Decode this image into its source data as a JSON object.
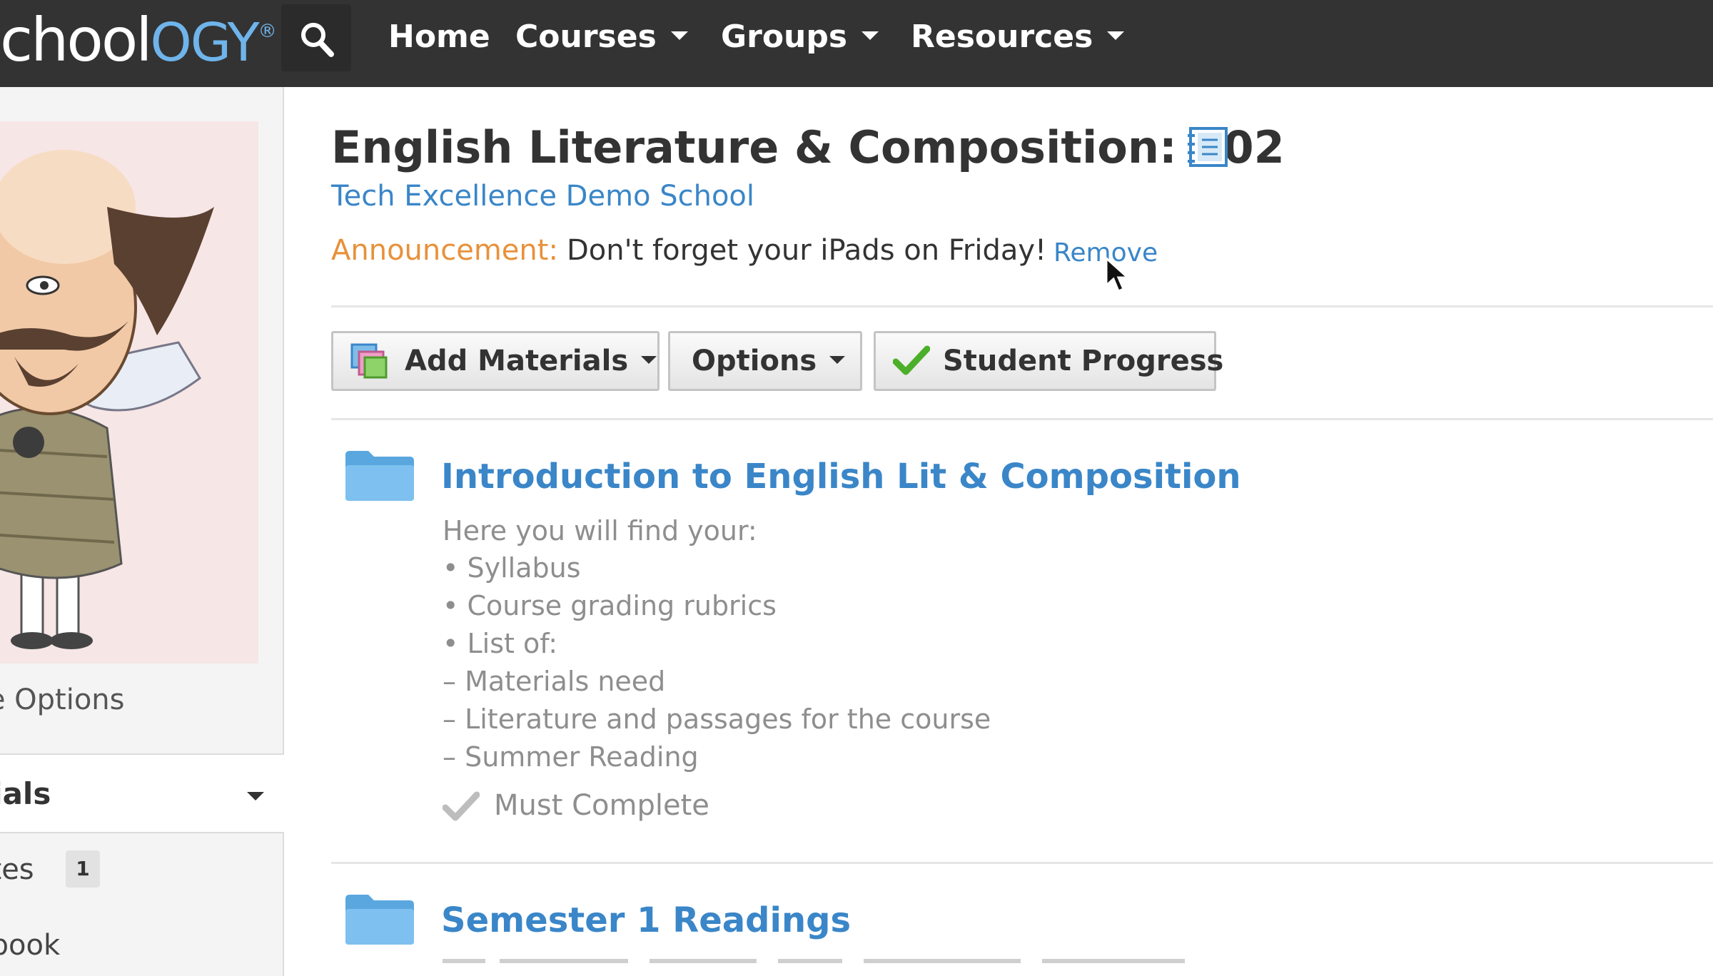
{
  "header": {
    "logo_main": "chool",
    "logo_accent": "ogy",
    "logo_mark": "®",
    "nav": [
      {
        "label": "Home",
        "has_caret": false
      },
      {
        "label": "Courses",
        "has_caret": true
      },
      {
        "label": "Groups",
        "has_caret": true
      },
      {
        "label": "Resources",
        "has_caret": true
      }
    ]
  },
  "sidebar": {
    "course_options_label": "se Options",
    "materials_label": "erials",
    "items": [
      {
        "label": "ates",
        "badge": "1"
      },
      {
        "label": "ebook"
      }
    ]
  },
  "course": {
    "title": "English Literature & Composition: 402",
    "school": "Tech Excellence Demo School",
    "announcement_label": "Announcement:",
    "announcement_text": "Don't forget your iPads on Friday!",
    "remove_label": "Remove"
  },
  "toolbar": {
    "add_materials_label": "Add Materials",
    "options_label": "Options",
    "student_progress_label": "Student Progress"
  },
  "folders": [
    {
      "title": "Introduction to English Lit & Composition",
      "description": [
        "Here you will find your:",
        "• Syllabus",
        "• Course grading rubrics",
        "• List of:",
        "– Materials need",
        "– Literature and passages for the course",
        "– Summer Reading"
      ],
      "completion": "Must Complete"
    },
    {
      "title": "Semester 1 Readings"
    }
  ],
  "colors": {
    "topbar": "#333333",
    "link_blue": "#3a86c8",
    "announcement_orange": "#e8913a",
    "folder_blue": "#5aa7df",
    "check_green": "#4caf2a"
  },
  "icons": [
    "search-icon",
    "notebook-icon",
    "add-materials-icon",
    "check-icon",
    "folder-icon",
    "cursor-icon"
  ]
}
